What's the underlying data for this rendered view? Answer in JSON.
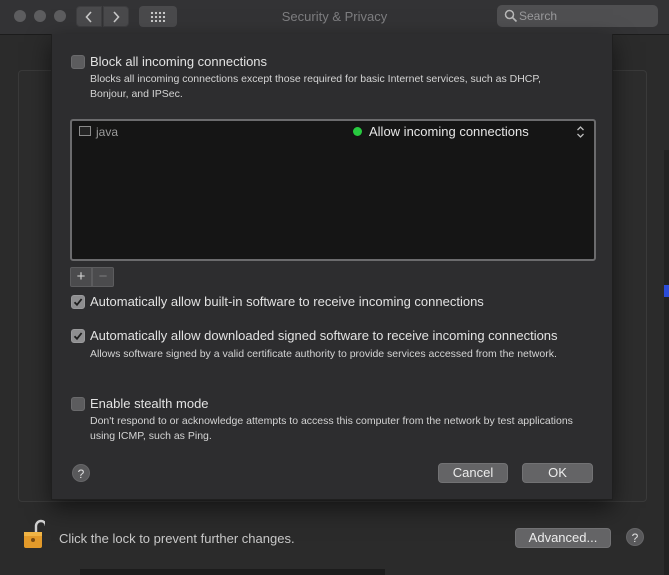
{
  "window": {
    "title": "Security & Privacy"
  },
  "search": {
    "placeholder": "Search",
    "value": ""
  },
  "sheet": {
    "block_all": {
      "label": "Block all incoming connections",
      "description": "Blocks all incoming connections except those required for basic Internet services,  such as DHCP, Bonjour, and IPSec.",
      "checked": false
    },
    "apps": [
      {
        "name": "java",
        "status": "Allow incoming connections",
        "status_color": "#27c93f",
        "icon": "app-window-icon"
      }
    ],
    "list_controls": {
      "add": "+",
      "remove": "−"
    },
    "auto_builtin": {
      "label": "Automatically allow built-in software to receive incoming connections",
      "checked": true
    },
    "auto_signed": {
      "label": "Automatically allow downloaded signed software to receive incoming connections",
      "description": "Allows software signed by a valid certificate authority to provide services accessed from the network.",
      "checked": true
    },
    "stealth": {
      "label": "Enable stealth mode",
      "description": "Don't respond to or acknowledge attempts to access this computer from the network by test applications using ICMP, such as Ping.",
      "checked": false
    },
    "help": "?",
    "cancel_label": "Cancel",
    "ok_label": "OK"
  },
  "footer": {
    "lock_text": "Click the lock to prevent further changes.",
    "advanced_label": "Advanced...",
    "help": "?"
  },
  "icons": {
    "lock": "lock-open-icon",
    "search": "search-icon",
    "grid": "grid-icon"
  }
}
